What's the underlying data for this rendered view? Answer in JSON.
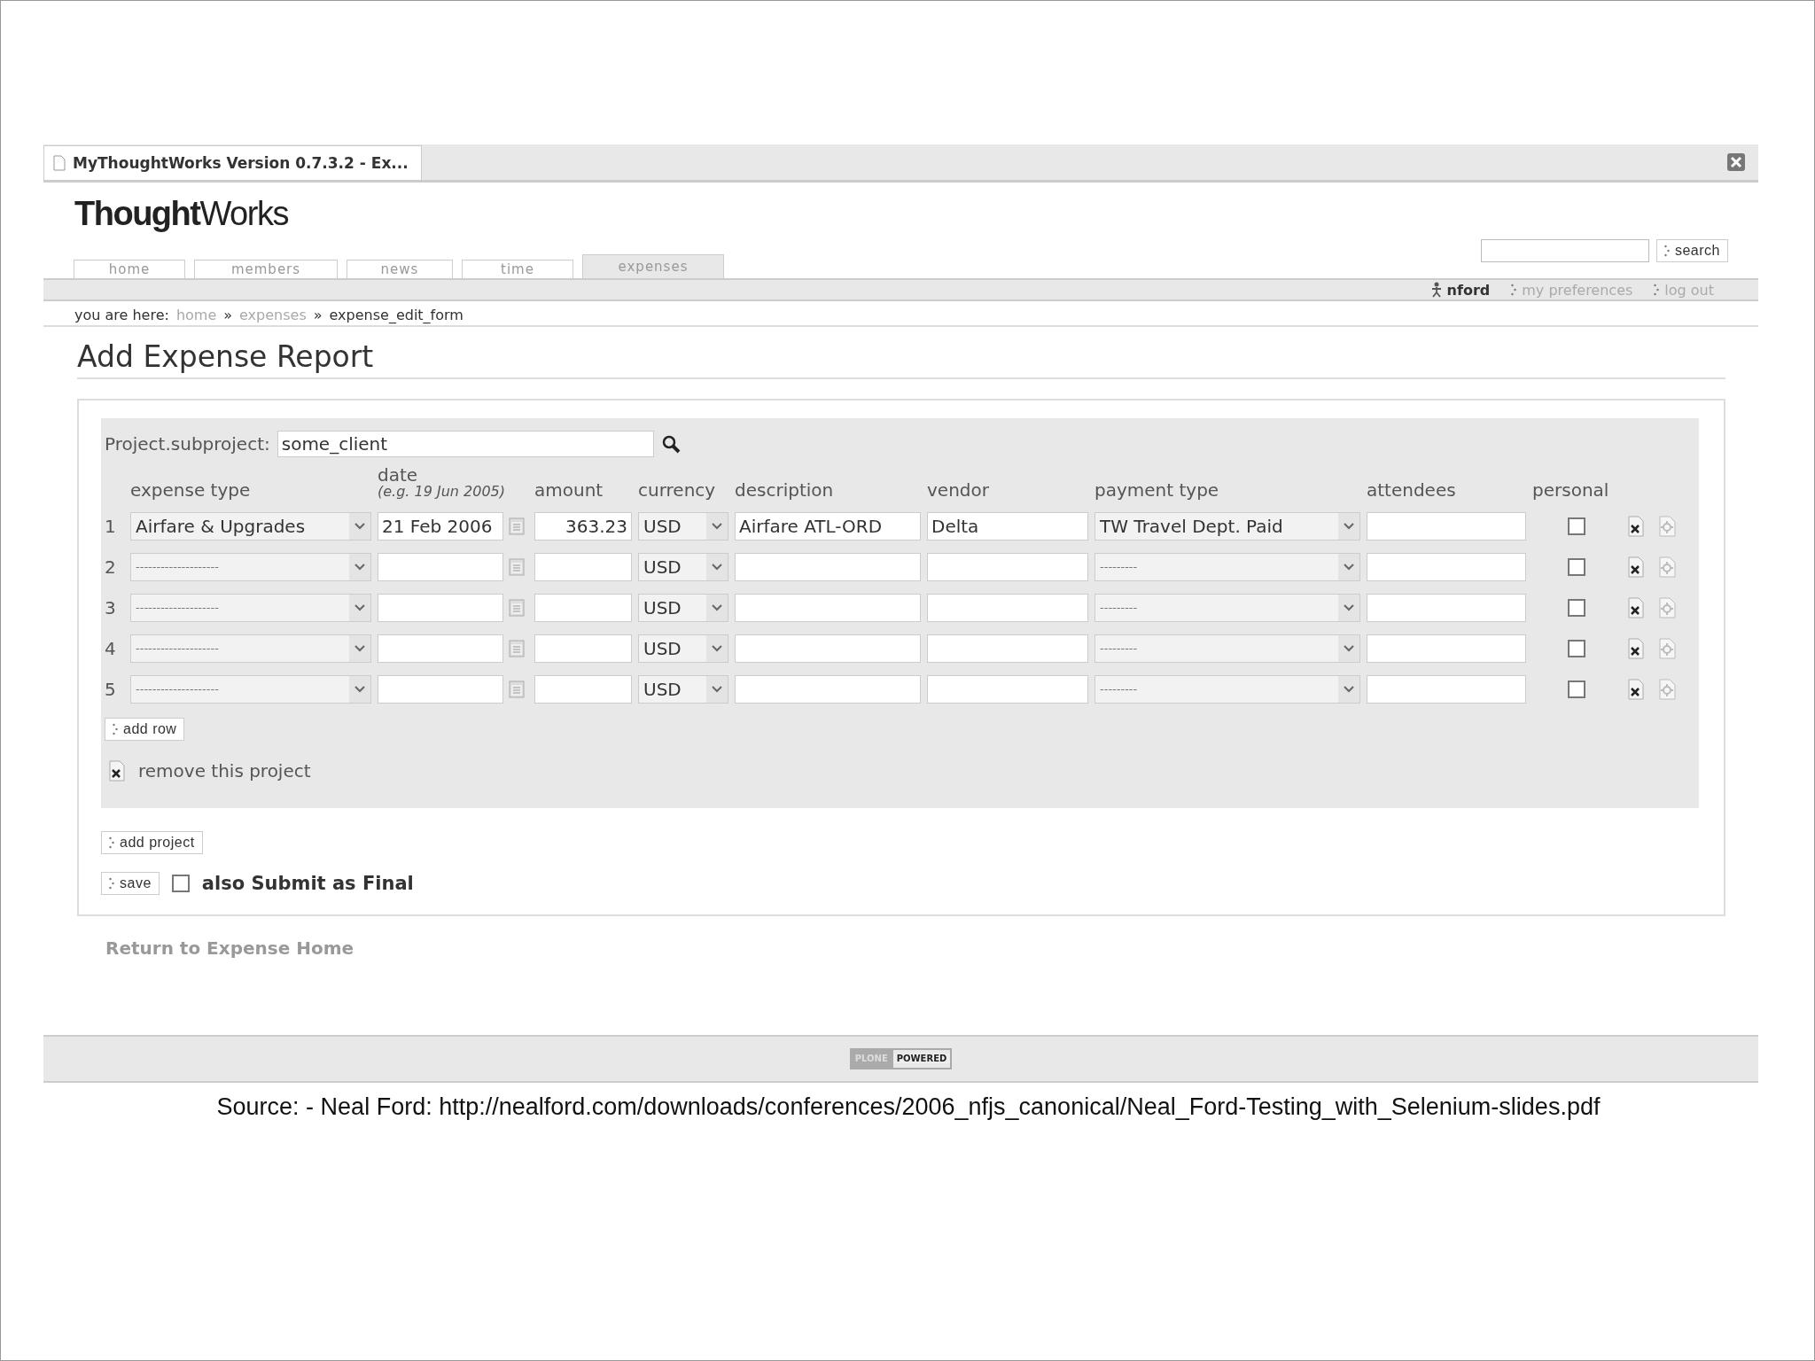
{
  "browser_tab": {
    "title": "MyThoughtWorks Version 0.7.3.2 - Ex..."
  },
  "logo": {
    "bold": "Thought",
    "light": "Works"
  },
  "search": {
    "button": "search"
  },
  "nav_tabs": [
    {
      "label": "home",
      "selected": false
    },
    {
      "label": "members",
      "selected": false
    },
    {
      "label": "news",
      "selected": false
    },
    {
      "label": "time",
      "selected": false
    },
    {
      "label": "expenses",
      "selected": true
    }
  ],
  "user_links": [
    {
      "kind": "user",
      "label": "nford"
    },
    {
      "kind": "link",
      "label": "my preferences"
    },
    {
      "kind": "link",
      "label": "log out"
    }
  ],
  "breadcrumb": {
    "prefix": "you are here:",
    "items": [
      {
        "label": "home",
        "current": false
      },
      {
        "label": "expenses",
        "current": false,
        "separator": "»"
      },
      {
        "label": "expense_edit_form",
        "current": true,
        "separator": "»"
      }
    ]
  },
  "heading": "Add Expense Report",
  "project": {
    "label": "Project.subproject:",
    "value": "some_client"
  },
  "columns": [
    {
      "label": "expense type"
    },
    {
      "label": "date",
      "hint": "(e.g. 19 Jun 2005)"
    },
    {
      "label": "amount"
    },
    {
      "label": "currency"
    },
    {
      "label": "description"
    },
    {
      "label": "vendor"
    },
    {
      "label": "payment type"
    },
    {
      "label": "attendees"
    },
    {
      "label": "personal"
    }
  ],
  "rows": [
    {
      "number": "1",
      "expense_type": "Airfare & Upgrades",
      "date": "21 Feb 2006",
      "amount": "363.23",
      "currency": "USD",
      "description": "Airfare ATL-ORD",
      "vendor": "Delta",
      "payment_type": "TW Travel Dept. Paid",
      "personal": false
    },
    {
      "number": "2",
      "expense_type": "--------------------",
      "currency": "USD",
      "payment_type": "---------",
      "personal": false
    },
    {
      "number": "3",
      "expense_type": "--------------------",
      "currency": "USD",
      "payment_type": "---------",
      "personal": false
    },
    {
      "number": "4",
      "expense_type": "--------------------",
      "currency": "USD",
      "payment_type": "---------",
      "personal": false
    },
    {
      "number": "5",
      "expense_type": "--------------------",
      "currency": "USD",
      "payment_type": "---------",
      "personal": false
    }
  ],
  "add_row": "add row",
  "remove_project": "remove this project",
  "add_project": "add project",
  "save": "save",
  "submit_final": {
    "label": "also Submit as Final",
    "checked": false
  },
  "return_link": "Return to Expense Home",
  "footer_badge": {
    "left": "PLONE",
    "right": "POWERED"
  },
  "source": "Source: - Neal Ford: http://nealford.com/downloads/conferences/2006_nfjs_canonical/Neal_Ford-Testing_with_Selenium-slides.pdf"
}
